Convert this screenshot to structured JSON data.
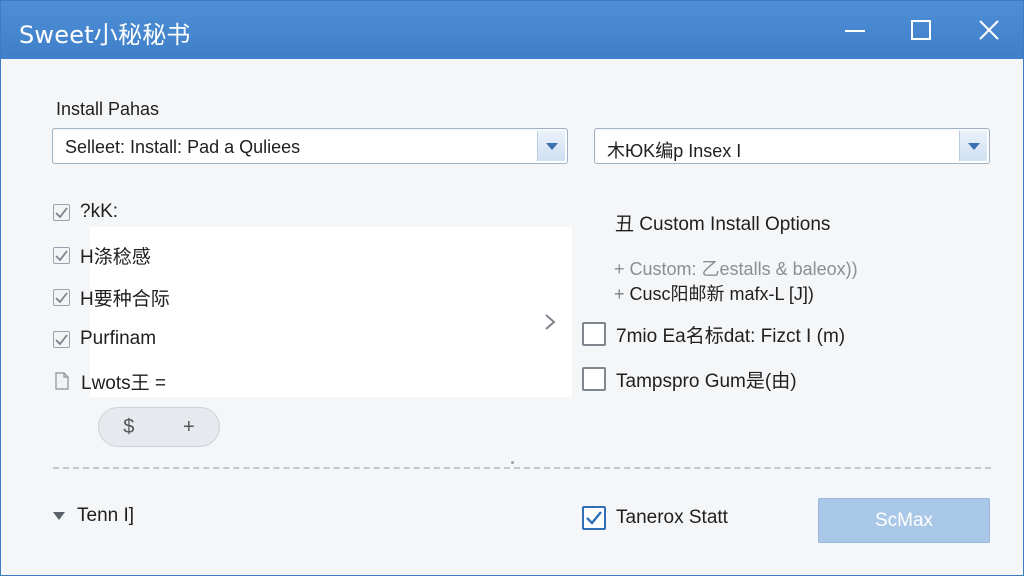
{
  "window": {
    "title": "Sweet小秘秘书",
    "colors": {
      "titlebar": "#4a8ad2",
      "accent": "#2f6fb8",
      "primary_button": "#a9c7e6"
    }
  },
  "paths": {
    "label": "Install Pahas",
    "selected": "Selleet: Install: Pad a Quliees"
  },
  "mode": {
    "selected": "木ЮK编p Insex I"
  },
  "components": [
    {
      "label": "?kK:",
      "checked": true
    },
    {
      "label": "H涤稔感",
      "checked": true
    },
    {
      "label": "H要种合际",
      "checked": true
    },
    {
      "label": "Purfinam",
      "checked": true
    },
    {
      "label": "Lwots王 =",
      "checked": false
    }
  ],
  "pill": {
    "left": "$",
    "right": "+"
  },
  "options": {
    "heading": "Custom Install Options",
    "heading_prefix": "丑",
    "lines": [
      {
        "prefix": "+",
        "text": "Custom: 乙estalls & baleox))"
      },
      {
        "prefix": "+",
        "text": "Cusc阳邮新 mafx-L [J])"
      }
    ],
    "checks": [
      {
        "label": "7mio Ea名标dat: Fizct I (m)",
        "checked": false
      },
      {
        "label": "Tampspro Gum是(由)",
        "checked": false
      }
    ]
  },
  "footer": {
    "toggle_label": "Tenn I]",
    "start_label": "Tanerox Statt",
    "start_checked": true,
    "primary_label": "ScMax"
  },
  "icons": {
    "minimize": "minimize-icon",
    "maximize": "maximize-icon",
    "close": "close-icon",
    "dropdown": "chevron-down-icon",
    "list_next": "chevron-right-icon",
    "collapse": "triangle-down-icon",
    "document": "document-icon"
  }
}
